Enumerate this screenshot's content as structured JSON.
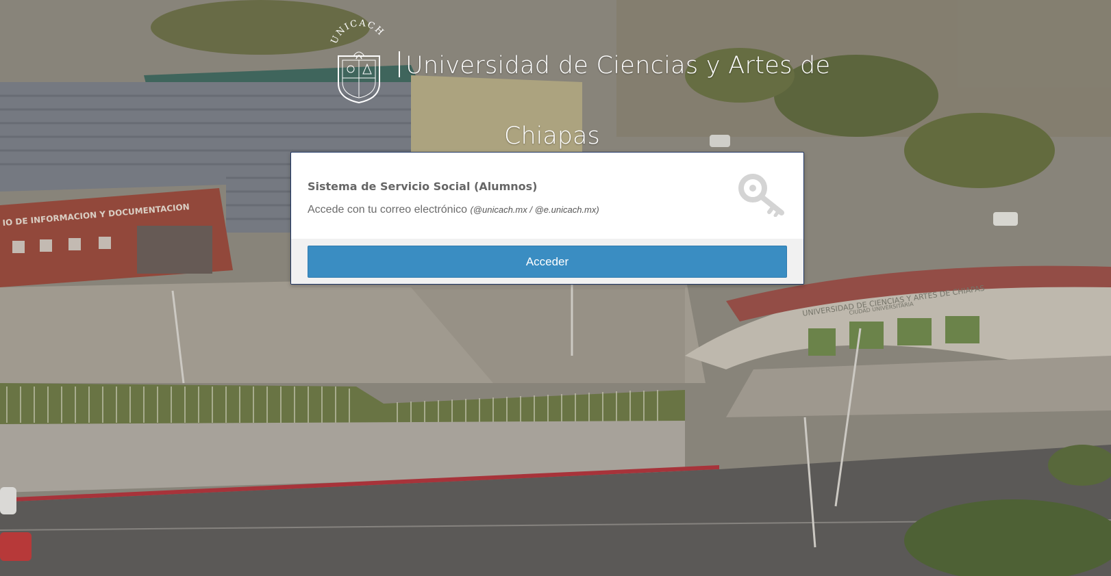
{
  "header": {
    "logo_text": "UNICACH",
    "title_line1": "Universidad de Ciencias y Artes de",
    "title_line2": "Chiapas"
  },
  "login_card": {
    "title": "Sistema de Servicio Social (Alumnos)",
    "subtitle": "Accede con tu correo electrónico",
    "domains": "(@unicach.mx / @e.unicach.mx)",
    "key_icon": "key-icon",
    "button_label": "Acceder"
  },
  "background": {
    "building_sign_left": "IO DE INFORMACION Y DOCUMENTACION",
    "building_sign_right": "UNIVERSIDAD DE CIENCIAS Y ARTES DE CHIAPAS",
    "building_sign_right_sub": "CIUDAD UNIVERSITARIA"
  },
  "colors": {
    "button": "#3a8dc2",
    "card_border": "#1f3563",
    "footer_bg": "#f1f1f1"
  }
}
